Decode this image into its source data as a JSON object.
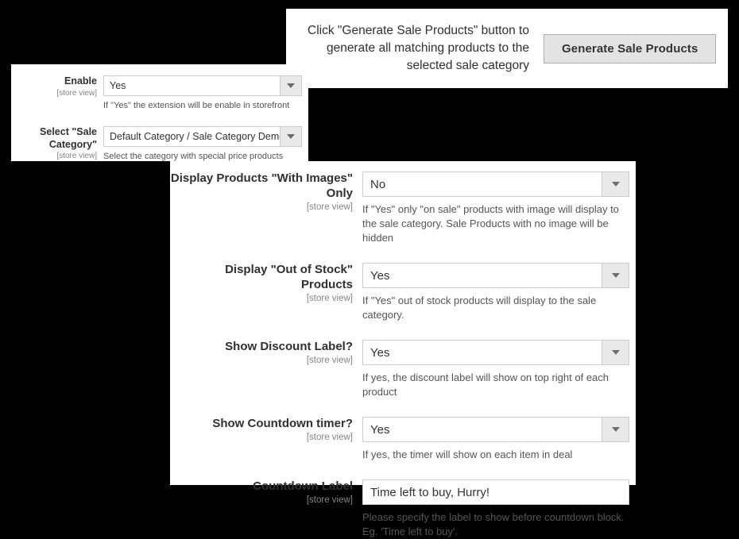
{
  "generate_panel": {
    "instruction": "Click \"Generate Sale Products\" button to generate all matching products to the selected sale category",
    "button_label": "Generate Sale Products"
  },
  "enable_panel": {
    "fields": [
      {
        "label": "Enable",
        "scope": "[store view]",
        "type": "select",
        "value": "Yes",
        "hint": "If \"Yes\" the extension will be enable in storefront"
      },
      {
        "label": "Select \"Sale Category\"",
        "scope": "[store view]",
        "type": "select",
        "value": "Default Category / Sale Category Demo",
        "hint": "Select the category with special price products"
      }
    ]
  },
  "main_panel": {
    "fields": [
      {
        "label": "Display Products \"With Images\" Only",
        "scope": "[store view]",
        "type": "select",
        "value": "No",
        "hint": "If \"Yes\" only \"on sale\" products with image will display to the sale category. Sale Products with no image will be hidden"
      },
      {
        "label": "Display \"Out of Stock\" Products",
        "scope": "[store view]",
        "type": "select",
        "value": "Yes",
        "hint": "If \"Yes\" out of stock products will display to the sale category."
      },
      {
        "label": "Show Discount Label?",
        "scope": "[store view]",
        "type": "select",
        "value": "Yes",
        "hint": "If yes, the discount label will show on top right of each product"
      },
      {
        "label": "Show Countdown timer?",
        "scope": "[store view]",
        "type": "select",
        "value": "Yes",
        "hint": "If yes, the timer will show on each item in deal"
      },
      {
        "label": "Countdown Label",
        "scope": "[store view]",
        "type": "text",
        "value": "Time left to buy, Hurry!",
        "hint": "Please specify the label to show before countdown block. Eg. 'Time left to buy'."
      }
    ]
  },
  "colors": {
    "background": "#000000",
    "panel": "#ffffff",
    "label": "#303030",
    "scope": "#858585",
    "hint": "#555555",
    "field_border": "#cccccc",
    "arrow_bg": "#e9e9e9",
    "button_bg": "#e3e3e3",
    "button_border": "#adadad"
  }
}
